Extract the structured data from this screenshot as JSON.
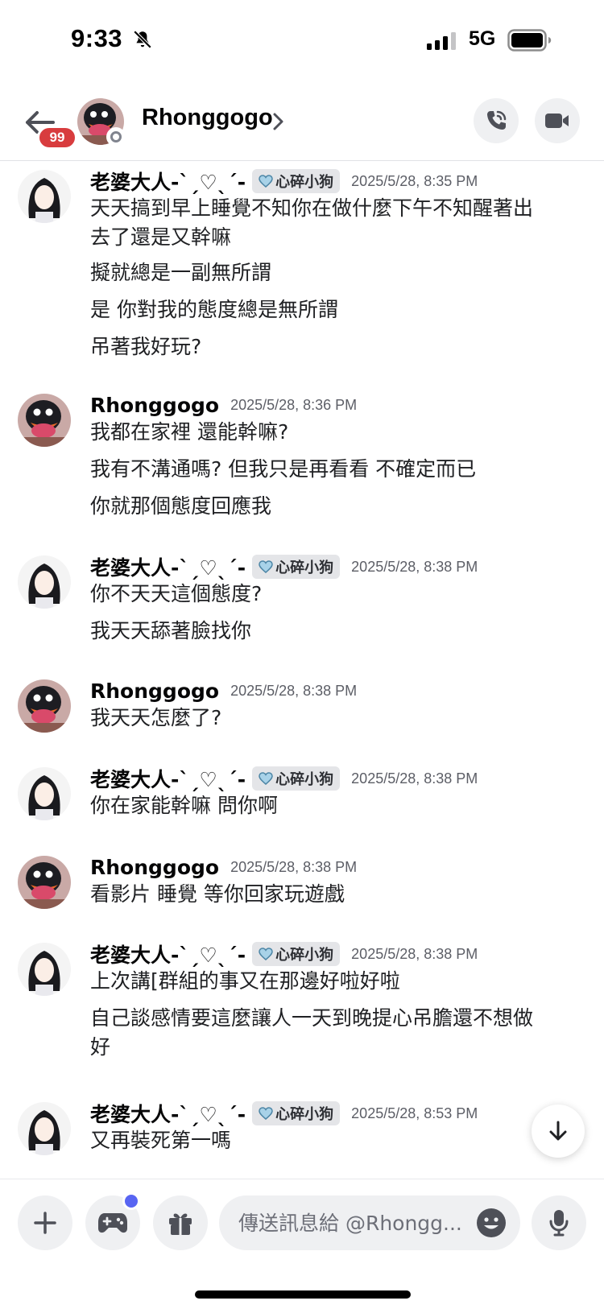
{
  "status_bar": {
    "time": "9:33",
    "network": "5G",
    "icons": [
      "mute-bell-icon",
      "signal-icon",
      "battery-icon"
    ]
  },
  "header": {
    "unread_count": "99",
    "name": "Rhonggogo",
    "icons": [
      "back-arrow-icon",
      "chevron-right-icon",
      "phone-call-icon",
      "video-camera-icon"
    ]
  },
  "messages": [
    {
      "author": "老婆大人-ˋˏ♡ˎˊ-",
      "role": "心碎小狗",
      "time": "2025/5/28, 8:35 PM",
      "lines": [
        "天天搞到早上睡覺不知你在做什麼下午不知醒著出",
        "去了還是又幹嘛",
        "擬就總是一副無所謂",
        "是 你對我的態度總是無所謂",
        "吊著我好玩?"
      ]
    },
    {
      "author": "Rhonggogo",
      "time": "2025/5/28, 8:36 PM",
      "lines": [
        "我都在家裡 還能幹嘛?",
        "我有不溝通嗎? 但我只是再看看 不確定而已",
        "你就那個態度回應我"
      ]
    },
    {
      "author": "老婆大人-ˋˏ♡ˎˊ-",
      "role": "心碎小狗",
      "time": "2025/5/28, 8:38 PM",
      "lines": [
        "你不天天這個態度?",
        "我天天舔著臉找你"
      ]
    },
    {
      "author": "Rhonggogo",
      "time": "2025/5/28, 8:38 PM",
      "lines": [
        "我天天怎麼了?"
      ]
    },
    {
      "author": "老婆大人-ˋˏ♡ˎˊ-",
      "role": "心碎小狗",
      "time": "2025/5/28, 8:38 PM",
      "lines": [
        "你在家能幹嘛 問你啊"
      ]
    },
    {
      "author": "Rhonggogo",
      "time": "2025/5/28, 8:38 PM",
      "lines": [
        "看影片 睡覺 等你回家玩遊戲"
      ]
    },
    {
      "author": "老婆大人-ˋˏ♡ˎˊ-",
      "role": "心碎小狗",
      "time": "2025/5/28, 8:38 PM",
      "lines": [
        "上次講[群組的事又在那邊好啦好啦",
        "自己談感情要這麼讓人一天到晚提心吊膽還不想做",
        "好"
      ]
    },
    {
      "author": "老婆大人-ˋˏ♡ˎˊ-",
      "role": "心碎小狗",
      "time": "2025/5/28, 8:53 PM",
      "lines": [
        "又再裝死第一嗎"
      ]
    }
  ],
  "composer": {
    "placeholder": "傳送訊息給 @Rhongg...",
    "icons": [
      "plus-icon",
      "gamepad-icon",
      "gift-icon",
      "emoji-icon",
      "microphone-icon",
      "arrow-down-icon"
    ]
  },
  "colors": {
    "badge_red": "#d83c3e",
    "blurple": "#5865f2",
    "button_gray": "#eff0f2",
    "role_tag_bg": "#e4e5e8"
  }
}
